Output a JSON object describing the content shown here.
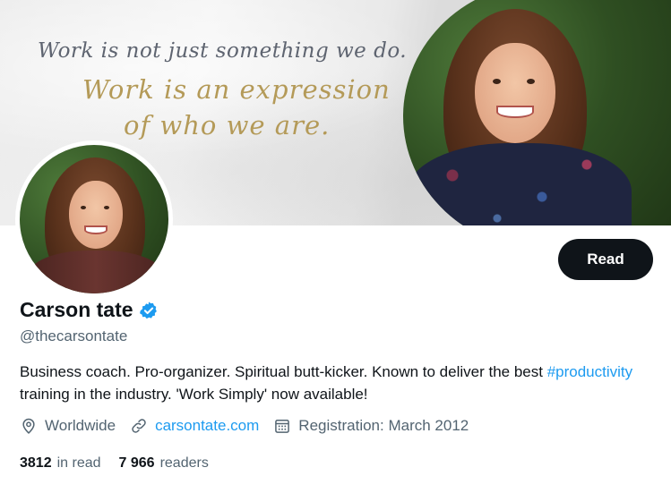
{
  "banner": {
    "quote_line_1": "Work is not just something we do.",
    "quote_line_2": "Work is an expression",
    "quote_line_3": "of who we are."
  },
  "profile": {
    "display_name": "Carson tate",
    "handle": "@thecarsontate",
    "verified": true,
    "bio_before": "Business coach. Pro-organizer. Spiritual butt-kicker. Known to deliver the best ",
    "bio_hashtag": "#productivity",
    "bio_after": " training in the industry. 'Work Simply' now available!"
  },
  "actions": {
    "read_label": "Read"
  },
  "meta": {
    "location": "Worldwide",
    "website": "carsontate.com",
    "registration": "Registration: March 2012"
  },
  "stats": {
    "in_read_count": "3812",
    "in_read_label": "in read",
    "readers_count": "7 966",
    "readers_label": "readers"
  },
  "colors": {
    "accent": "#1d9bf0",
    "button_bg": "#0f1419",
    "muted_text": "#536471",
    "quote_gold": "#b49a58"
  },
  "icons": [
    "verified-badge-icon",
    "location-pin-icon",
    "link-icon",
    "calendar-icon"
  ]
}
